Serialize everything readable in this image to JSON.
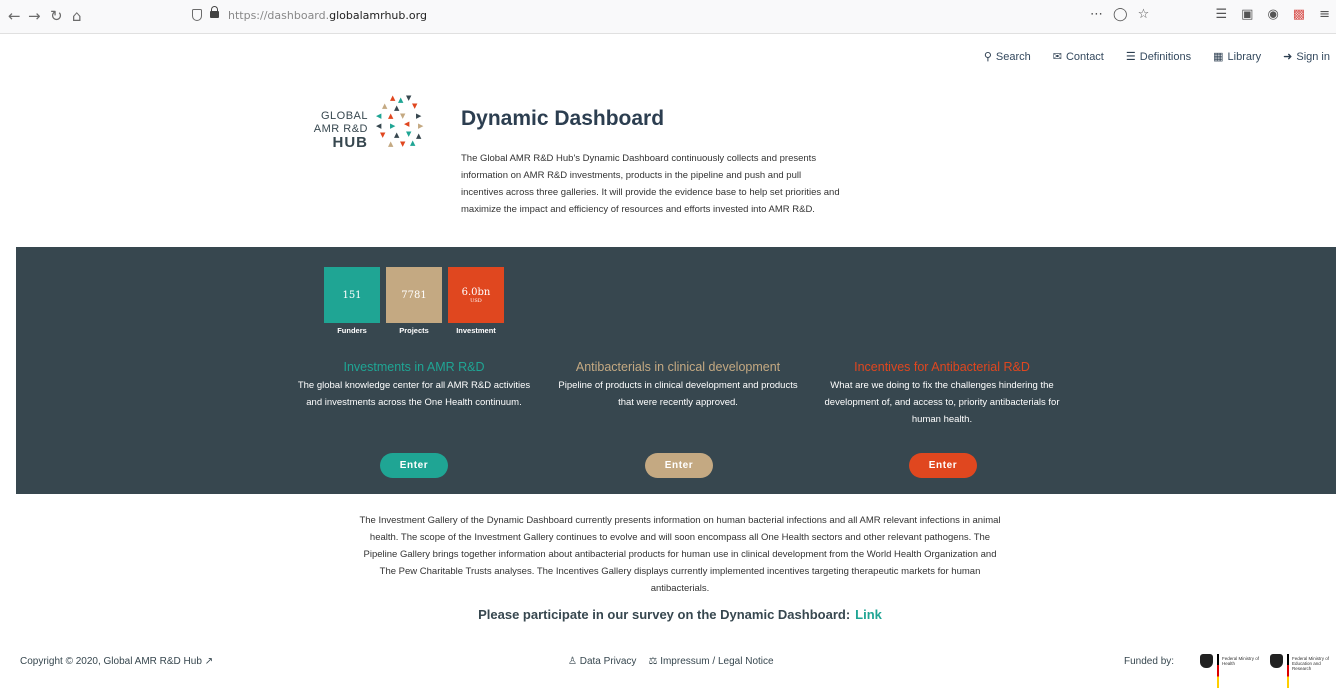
{
  "browser": {
    "url_prefix": "https://dashboard.",
    "url_domain": "globalamrhub.org"
  },
  "nav": {
    "search": "Search",
    "contact": "Contact",
    "definitions": "Definitions",
    "library": "Library",
    "signin": "Sign in"
  },
  "logo": {
    "line1": "GLOBAL",
    "line2": "AMR R&D",
    "line3": "HUB"
  },
  "header": {
    "title": "Dynamic Dashboard",
    "intro": "The Global AMR R&D Hub's Dynamic Dashboard continuously collects and presents information on AMR R&D investments, products in the pipeline and push and pull incentives across three galleries. It will provide the evidence base to help set priorities and maximize the impact and efficiency of resources and efforts invested into AMR R&D."
  },
  "stats": [
    {
      "value": "151",
      "sub": "",
      "label": "Funders",
      "color": "#1fa594"
    },
    {
      "value": "7781",
      "sub": "",
      "label": "Projects",
      "color": "#c4a982"
    },
    {
      "value": "6.0bn",
      "sub": "USD",
      "label": "Investment",
      "color": "#e0471f"
    }
  ],
  "galleries": [
    {
      "title": "Investments in AMR R&D",
      "desc": "The global knowledge center for all AMR R&D activities and investments across the One Health continuum.",
      "button": "Enter",
      "color": "#1fa594"
    },
    {
      "title": "Antibacterials in clinical development",
      "desc": "Pipeline of products in clinical development and products that were recently approved.",
      "button": "Enter",
      "color": "#c4a982"
    },
    {
      "title": "Incentives for Antibacterial R&D",
      "desc": "What are we doing to fix the challenges hindering the development of, and access to, priority antibacterials for human health.",
      "button": "Enter",
      "color": "#e0471f"
    }
  ],
  "info": {
    "text": "The Investment Gallery of the Dynamic Dashboard currently presents information on human bacterial infections and all AMR relevant infections in animal health. The scope of the Investment Gallery continues to evolve and will soon encompass all One Health sectors and other relevant pathogens. The Pipeline Gallery brings together information about antibacterial products for human use in clinical development from the World Health Organization and The Pew Charitable Trusts analyses. The Incentives Gallery displays currently implemented incentives targeting therapeutic markets for human antibacterials."
  },
  "survey": {
    "text": "Please participate in our survey on the Dynamic Dashboard:",
    "link": "Link"
  },
  "footer": {
    "copyright": "Copyright © 2020,",
    "copyright_link": "Global AMR R&D Hub",
    "privacy": "Data Privacy",
    "impressum": "Impressum / Legal Notice",
    "funded_by": "Funded by:",
    "ministry1": "Federal Ministry of Health",
    "ministry2": "Federal Ministry of Education and Research"
  }
}
